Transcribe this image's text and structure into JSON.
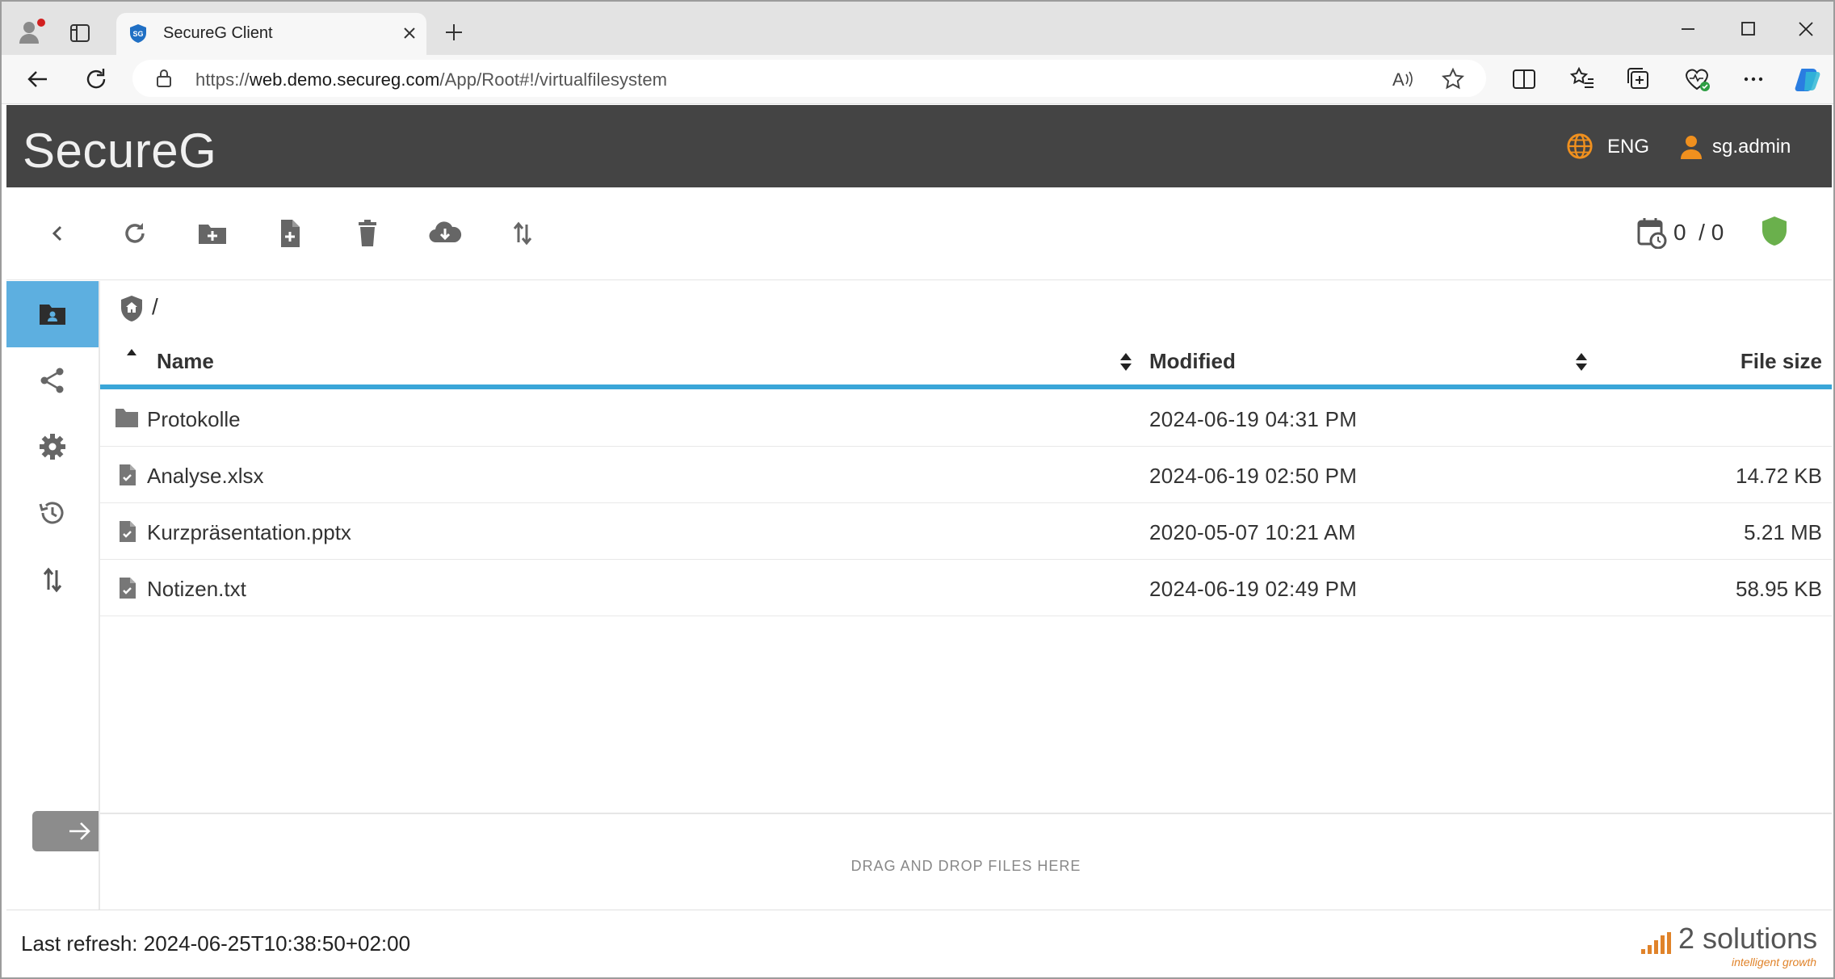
{
  "browser": {
    "tab_title": "SecureG Client",
    "url_prefix": "https://",
    "url_host": "web.demo.secureg.com",
    "url_path": "/App/Root#!/virtualfilesystem"
  },
  "app": {
    "brand": "SecureG",
    "language": "ENG",
    "user": "sg.admin",
    "counter": "0  / 0"
  },
  "breadcrumb": {
    "path": "/"
  },
  "table": {
    "columns": [
      "Name",
      "Modified",
      "File size"
    ],
    "rows": [
      {
        "name": "Protokolle",
        "modified": "2024-06-19 04:31 PM",
        "size": "",
        "type": "folder"
      },
      {
        "name": "Analyse.xlsx",
        "modified": "2024-06-19 02:50 PM",
        "size": "14.72 KB",
        "type": "file"
      },
      {
        "name": "Kurzpräsentation.pptx",
        "modified": "2020-05-07 10:21 AM",
        "size": "5.21 MB",
        "type": "file"
      },
      {
        "name": "Notizen.txt",
        "modified": "2024-06-19 02:49 PM",
        "size": "58.95 KB",
        "type": "file"
      }
    ]
  },
  "dropzone": {
    "label": "DRAG AND DROP FILES HERE"
  },
  "footer": {
    "last_refresh": "Last refresh: 2024-06-25T10:38:50+02:00",
    "logo_text": "2 solutions",
    "logo_tagline": "intelligent growth"
  },
  "colors": {
    "header_bg": "#444444",
    "accent_blue": "#3aa6d8",
    "sidebar_active": "#5dafe0",
    "orange": "#f0901e",
    "shield_green": "#6ab04c"
  },
  "icons": {
    "sidebar": [
      "folder-user-icon",
      "share-icon",
      "gear-icon",
      "history-icon",
      "transfer-icon"
    ],
    "toolbar": [
      "back-icon",
      "refresh-icon",
      "new-folder-icon",
      "new-file-icon",
      "delete-icon",
      "download-icon",
      "transfer-icon",
      "calendar-clock-icon",
      "shield-icon"
    ]
  }
}
